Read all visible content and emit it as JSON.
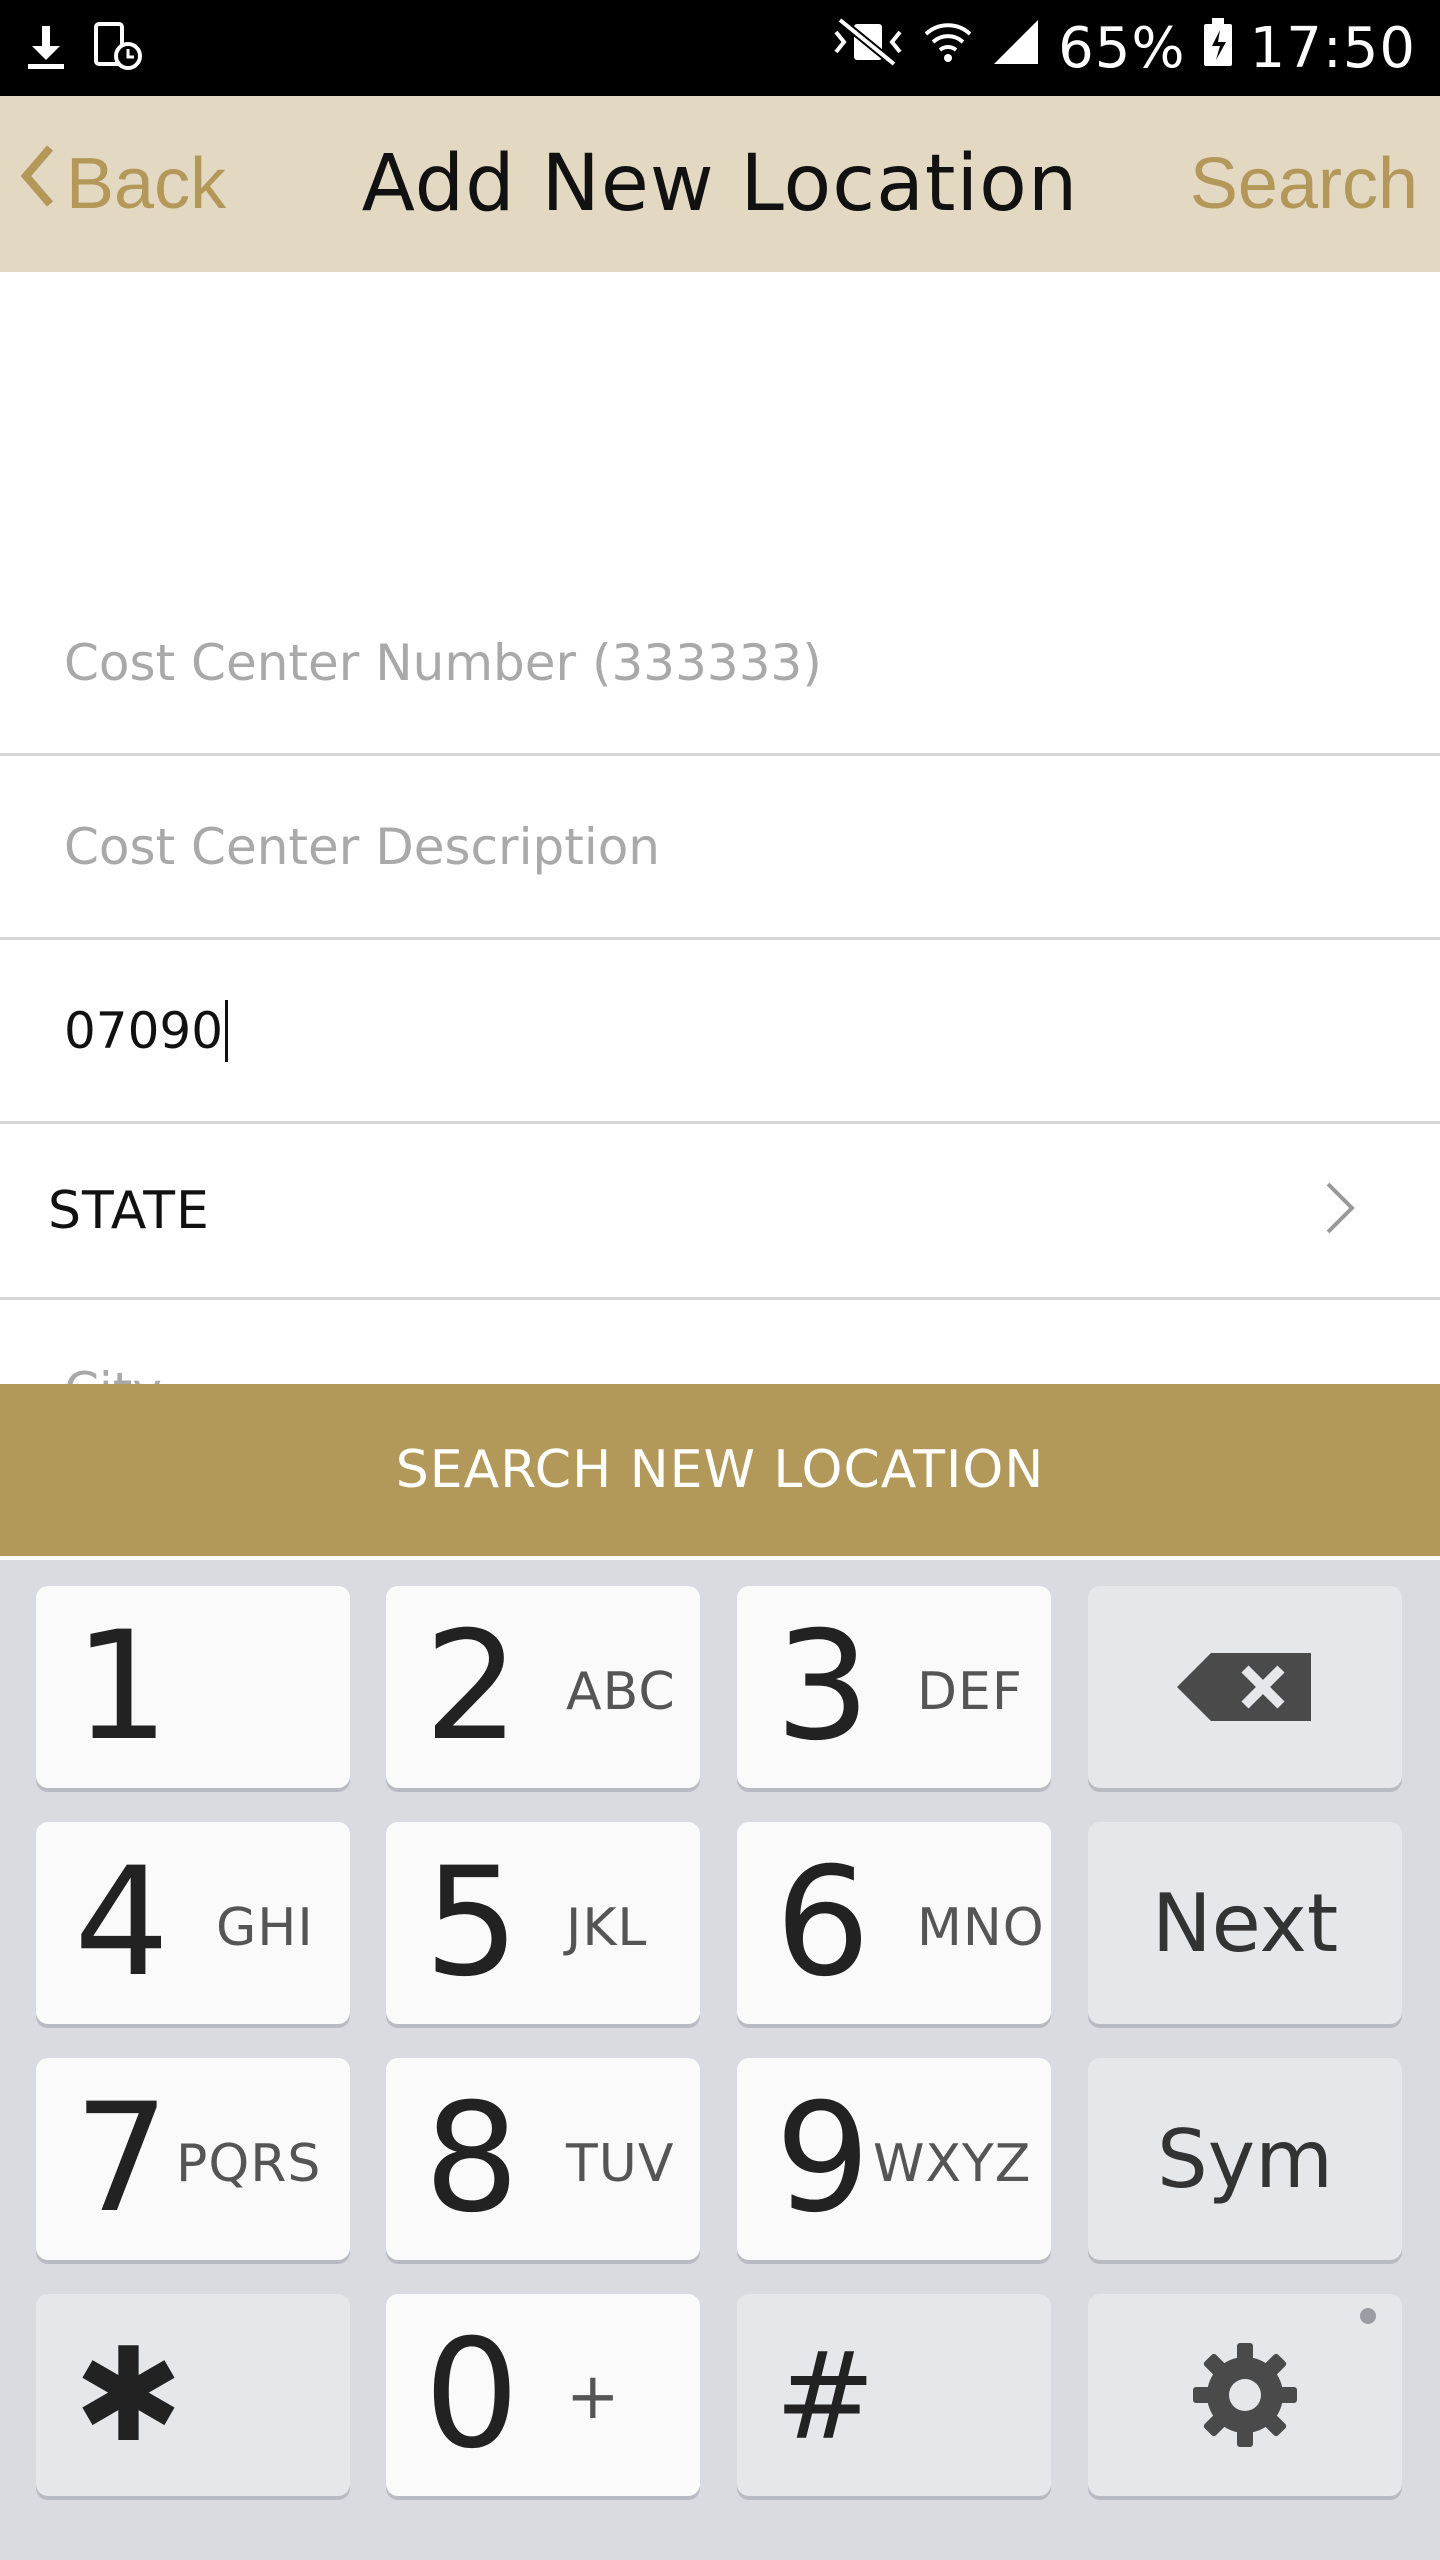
{
  "status_bar": {
    "battery": "65%",
    "time": "17:50"
  },
  "nav": {
    "back_label": "Back",
    "title": "Add New Location",
    "search_label": "Search"
  },
  "form": {
    "cost_center_number_placeholder": "Cost Center Number (333333)",
    "cost_center_description_placeholder": "Cost Center Description",
    "zip_value": "07090",
    "state_label": "STATE",
    "city_placeholder": "City"
  },
  "primary_button": "SEARCH NEW LOCATION",
  "keyboard": {
    "keys": [
      {
        "num": "1",
        "sub": ""
      },
      {
        "num": "2",
        "sub": "ABC"
      },
      {
        "num": "3",
        "sub": "DEF"
      },
      {
        "num": "4",
        "sub": "GHI"
      },
      {
        "num": "5",
        "sub": "JKL"
      },
      {
        "num": "6",
        "sub": "MNO"
      },
      {
        "num": "7",
        "sub": "PQRS"
      },
      {
        "num": "8",
        "sub": "TUV"
      },
      {
        "num": "9",
        "sub": "WXYZ"
      },
      {
        "num": "✱",
        "sub": ""
      },
      {
        "num": "0",
        "sub": "+"
      },
      {
        "num": "#",
        "sub": ""
      }
    ],
    "next_label": "Next",
    "sym_label": "Sym"
  },
  "colors": {
    "accent": "#b39959",
    "nav_bg": "#e3d9c3",
    "nav_text": "#b4985a"
  }
}
